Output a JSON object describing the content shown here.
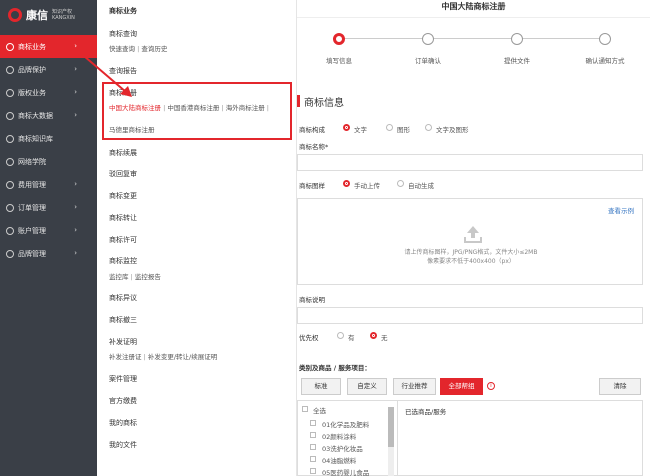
{
  "brand": {
    "name": "康信",
    "sub_line1": "知识产权",
    "sub_line2": "KANGXIN",
    "accent": "#e3262c"
  },
  "nav": {
    "items": [
      {
        "label": "商标业务",
        "icon": "circle-icon",
        "active": true
      },
      {
        "label": "品牌保护",
        "icon": "shield-icon"
      },
      {
        "label": "版权业务",
        "icon": "copyright-icon"
      },
      {
        "label": "商标大数据",
        "icon": "database-icon"
      },
      {
        "label": "商标知识库",
        "icon": "book-icon"
      },
      {
        "label": "网络学院",
        "icon": "cap-icon"
      },
      {
        "label": "费用管理",
        "icon": "wallet-icon"
      },
      {
        "label": "订单管理",
        "icon": "order-icon"
      },
      {
        "label": "账户管理",
        "icon": "gear-icon"
      },
      {
        "label": "品牌管理",
        "icon": "brand-icon"
      }
    ]
  },
  "panel": {
    "title": "商标业务",
    "query_title": "商标查询",
    "query_links": [
      "快速查询",
      "查询历史"
    ],
    "report_title": "查询报告",
    "register_title": "商标注册",
    "register_links": [
      "中国大陆商标注册",
      "中国香港商标注册",
      "海外商标注册",
      "马德里商标注册"
    ],
    "renew": "商标续展",
    "reject_review": "驳回复审",
    "change": "商标变更",
    "transfer": "商标转让",
    "license": "商标许可",
    "monitor_title": "商标监控",
    "monitor_links": [
      "监控库",
      "监控报告"
    ],
    "dispute": "商标异议",
    "cancel3": "商标撤三",
    "cert_title": "补发证明",
    "cert_links": [
      "补发注册证",
      "补发变更/转让/续展证明"
    ],
    "case_mgmt": "案件管理",
    "official": "官方缴费",
    "my_tm": "我的商标",
    "my_files": "我的文件"
  },
  "main": {
    "title": "中国大陆商标注册",
    "steps": [
      "填写信息",
      "订单确认",
      "提供文件",
      "确认通知方式"
    ],
    "section_heading": "商标信息",
    "composition_label": "商标构成",
    "composition_options": [
      "文字",
      "图形",
      "文字及图形"
    ],
    "name_label": "商标名称*",
    "pattern_label": "商标图样",
    "pattern_options": [
      "手动上传",
      "自动生成"
    ],
    "view_example": "查看示例",
    "upload_hint1": "请上传商标图样，JPG/PNG格式，文件大小≤2MB",
    "upload_hint2": "像素要求不低于400x400（px）",
    "desc_label": "商标说明",
    "priority_label": "优先权",
    "priority_options": [
      "有",
      "无"
    ],
    "goods_label": "类别及商品 / 服务项目：",
    "goods_tabs": [
      "标准",
      "自定义",
      "行业推荐",
      "全部帮组"
    ],
    "clear_btn": "清除",
    "select_all": "全选",
    "classes": [
      "01化学品及肥料",
      "02颜料涂料",
      "03洗护化妆品",
      "04油脂燃料",
      "05医药婴儿食品"
    ],
    "selected_label": "已选商品/服务"
  }
}
